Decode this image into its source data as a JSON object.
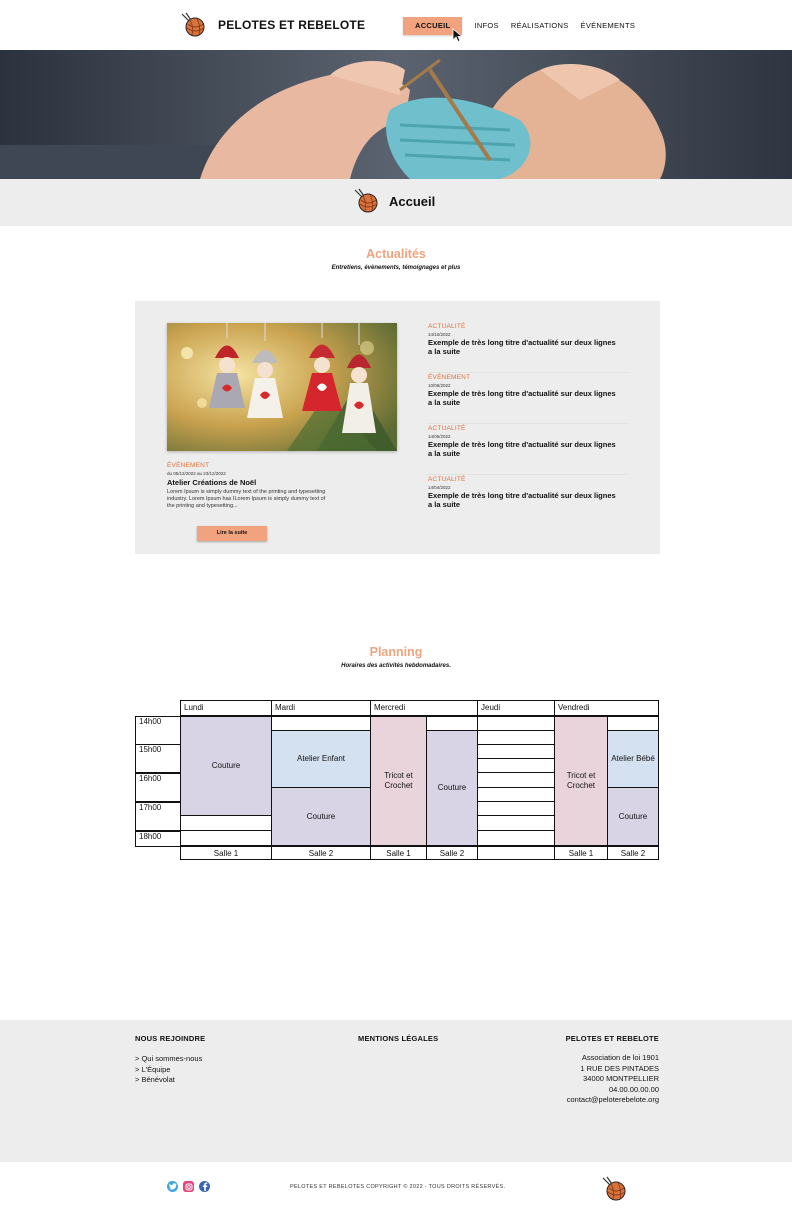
{
  "header": {
    "brand": "PELOTES ET REBELOTE",
    "nav": [
      {
        "label": "ACCUEIL",
        "active": true
      },
      {
        "label": "INFOS",
        "active": false
      },
      {
        "label": "RÉALISATIONS",
        "active": false
      },
      {
        "label": "ÉVÉNEMENTS",
        "active": false
      }
    ]
  },
  "page_title": "Accueil",
  "news": {
    "title": "Actualités",
    "subtitle": "Entretiens, évènements, témoignages et plus",
    "featured": {
      "category": "ÉVÉNEMENT",
      "date": "du 05/12/2022 au 23/12/2022",
      "title": "Atelier Créations de Noël",
      "text": "Lorem Ipsum is simply dummy text of the printing and typesetting industry. Lorem Ipsum has ILorem Ipsum is simply dummy text of the printing and typesetting...",
      "button": "Lire la suite"
    },
    "items": [
      {
        "category": "ACTUALITÉ",
        "date": "14/10/2022",
        "title": "Exemple de très long titre d'actualité sur deux lignes a la suite"
      },
      {
        "category": "ÉVÉNEMENT",
        "date": "10/06/2022",
        "title": "Exemple de très long titre d'actualité sur deux lignes a la suite"
      },
      {
        "category": "ACTUALITÉ",
        "date": "14/05/2022",
        "title": "Exemple de très long titre d'actualité sur deux lignes a la suite"
      },
      {
        "category": "ACTUALITÉ",
        "date": "14/04/2022",
        "title": "Exemple de très long titre d'actualité sur deux lignes a la suite"
      }
    ]
  },
  "planning": {
    "title": "Planning",
    "subtitle": "Horaires des activités hebdomadaires.",
    "days": [
      "Lundi",
      "Mardi",
      "Mercredi",
      "Jeudi",
      "Vendredi"
    ],
    "times": [
      "14h00",
      "15h00",
      "16h00",
      "17h00",
      "18h00"
    ],
    "activities": {
      "lundi": "Couture",
      "mardi_1": "Atelier Enfant",
      "mardi_2": "Couture",
      "mercredi_1": "Tricot et Crochet",
      "mercredi_2": "Couture",
      "vendredi_1": "Tricot et Crochet",
      "vendredi_2a": "Atelier Bébé",
      "vendredi_2b": "Couture"
    },
    "rooms": [
      "Salle 1",
      "Salle 2",
      "Salle 1",
      "Salle 2",
      "Salle 1",
      "Salle 2"
    ]
  },
  "footer": {
    "col1_title": "NOUS REJOINDRE",
    "links": [
      "> Qui sommes-nous",
      "> L'Équipe",
      "> Bénévolat"
    ],
    "col2_title": "MENTIONS LÉGALES",
    "col3_title": "PELOTES ET REBELOTE",
    "address": [
      "Association de loi 1901",
      "1 RUE DES PINTADES",
      "34000 MONTPELLIER",
      "04.00.00.00.00",
      "contact@peloterebelote.org"
    ],
    "copyright": "PELOTES ET REBELOTES COPYRIGHT © 2022 - TOUS DROITS RÉSERVÉS."
  },
  "colors": {
    "accent": "#f0a37e",
    "accent_text": "#e36f38",
    "panel": "#ededed",
    "purple": "#d9d3e6",
    "blue": "#d4e1f0",
    "pink": "#e9d4dc"
  },
  "icons": [
    "yarn-ball-icon",
    "cursor-icon",
    "twitter-icon",
    "instagram-icon",
    "facebook-icon"
  ]
}
